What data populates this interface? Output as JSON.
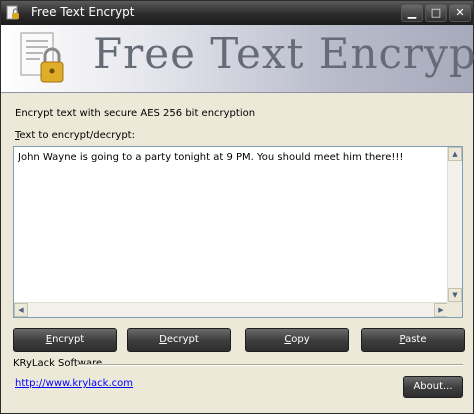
{
  "window": {
    "title": "Free Text Encrypt"
  },
  "banner": {
    "title": "Free Text Encrypt",
    "icon": "document-lock-icon"
  },
  "description": "Encrypt text with secure AES 256 bit encryption",
  "text_area": {
    "label_prefix": "T",
    "label_rest": "ext to encrypt/decrypt:",
    "value": "John Wayne is going to a party tonight at 9 PM. You should meet him there!!!"
  },
  "buttons": {
    "encrypt_first": "E",
    "encrypt_rest": "ncrypt",
    "decrypt_first": "D",
    "decrypt_rest": "ecrypt",
    "copy_first": "C",
    "copy_rest": "opy",
    "paste_first": "P",
    "paste_rest": "aste",
    "about": "About..."
  },
  "footer": {
    "company": "KRyLack Software",
    "link": "http://www.krylack.com"
  },
  "colors": {
    "titlebar": "#2b2b2b",
    "window_bg": "#ece9d8",
    "banner_text": "#666b78",
    "link": "#0000ff"
  }
}
